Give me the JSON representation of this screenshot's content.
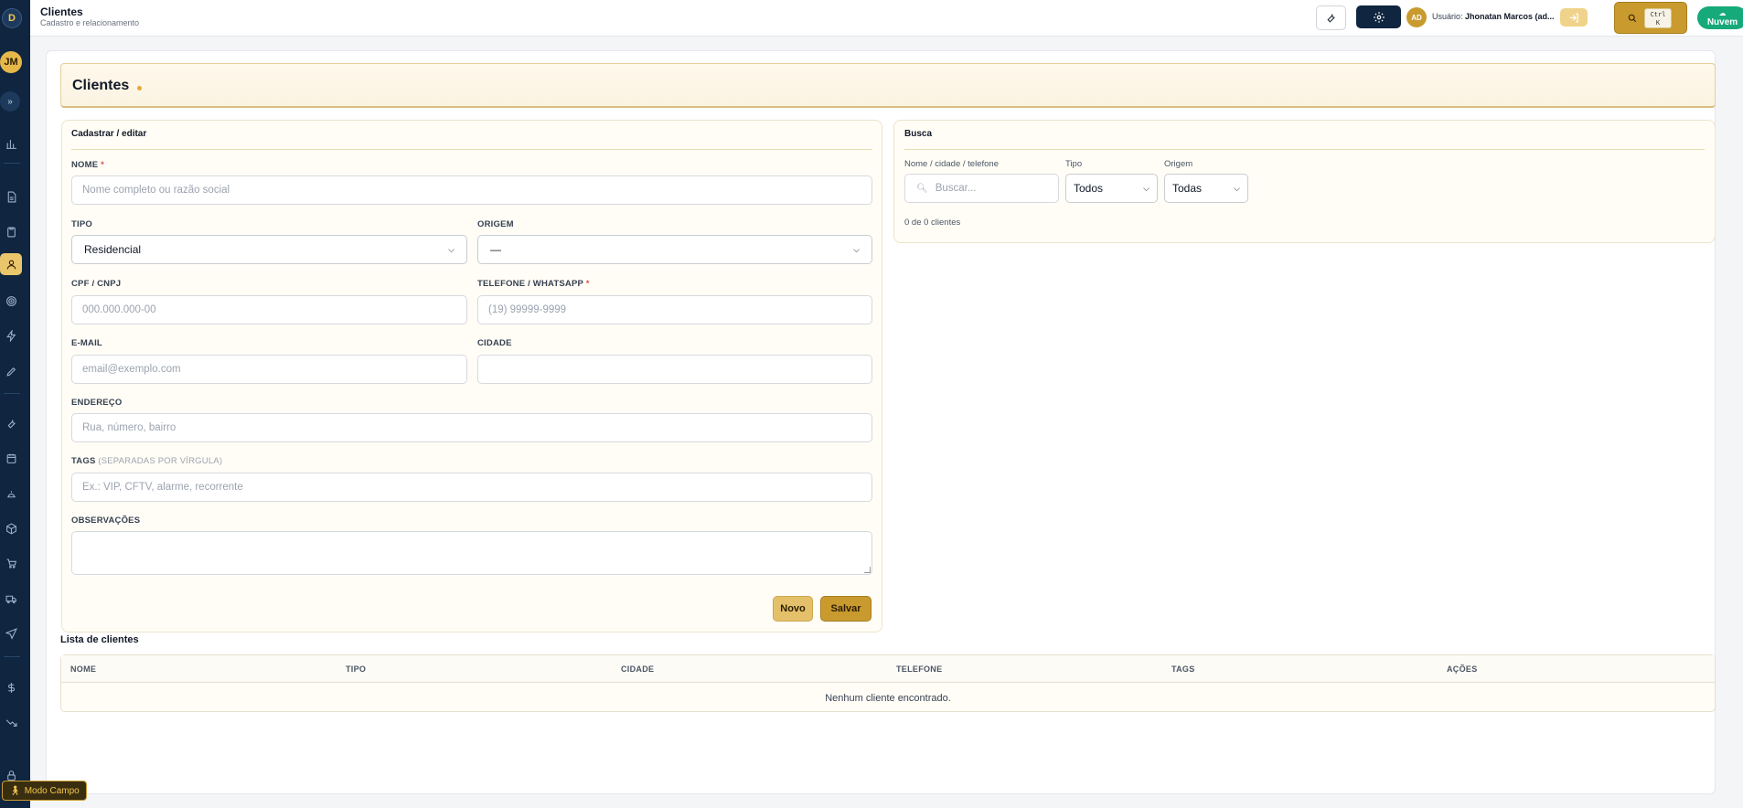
{
  "sidebar": {
    "logo": "D",
    "avatar": "JM",
    "expand_glyph": "»",
    "icons": [
      "bar-chart-icon",
      "document-icon",
      "clipboard-icon",
      "user-icon",
      "target-icon",
      "lightning-icon",
      "pencil-icon",
      "wrench-icon",
      "calendar-icon",
      "bell-icon",
      "package-icon",
      "cart-icon",
      "truck-icon",
      "send-icon",
      "dollar-icon",
      "trend-down-icon",
      "lock-icon"
    ],
    "active_icon": "user-icon",
    "modo_campo": "Modo Campo"
  },
  "header": {
    "title": "Clientes",
    "subtitle": "Cadastro e relacionamento",
    "avatar": "AD",
    "user_prefix": "Usuário:",
    "user_name": "Jhonatan Marcos (ad...",
    "kbd_line1": "Ctrl",
    "kbd_line2": "K",
    "cloud_label": "Nuvem"
  },
  "page": {
    "title": "Clientes"
  },
  "form": {
    "title": "Cadastrar / editar",
    "nome_label": "NOME",
    "nome_placeholder": "Nome completo ou razão social",
    "tipo_label": "TIPO",
    "tipo_value": "Residencial",
    "origem_label": "ORIGEM",
    "origem_value": "—",
    "cpf_label": "CPF / CNPJ",
    "cpf_placeholder": "000.000.000-00",
    "telefone_label": "TELEFONE / WHATSAPP",
    "telefone_placeholder": "(19) 99999-9999",
    "email_label": "E-MAIL",
    "email_placeholder": "email@exemplo.com",
    "cidade_label": "CIDADE",
    "cidade_value": "",
    "endereco_label": "ENDEREÇO",
    "endereco_placeholder": "Rua, número, bairro",
    "tags_label": "TAGS",
    "tags_hint": "(SEPARADAS POR VÍRGULA)",
    "tags_placeholder": "Ex.: VIP, CFTV, alarme, recorrente",
    "obs_label": "OBSERVAÇÕES",
    "required_mark": "*",
    "novo_button": "Novo",
    "salvar_button": "Salvar"
  },
  "search": {
    "title": "Busca",
    "query_label": "Nome / cidade / telefone",
    "query_placeholder": "Buscar...",
    "tipo_label": "Tipo",
    "tipo_value": "Todos",
    "origem_label": "Origem",
    "origem_value": "Todas",
    "count_text": "0 de 0 clientes"
  },
  "list": {
    "title": "Lista de clientes",
    "columns": [
      "NOME",
      "TIPO",
      "CIDADE",
      "TELEFONE",
      "TAGS",
      "AÇÕES"
    ],
    "empty_text": "Nenhum cliente encontrado."
  },
  "colors": {
    "sidebar_bg": "#0f2540",
    "accent_gold": "#c99a2e",
    "accent_light_gold": "#e4c06a",
    "cloud_green": "#16a97a",
    "required_red": "#d9534f"
  }
}
